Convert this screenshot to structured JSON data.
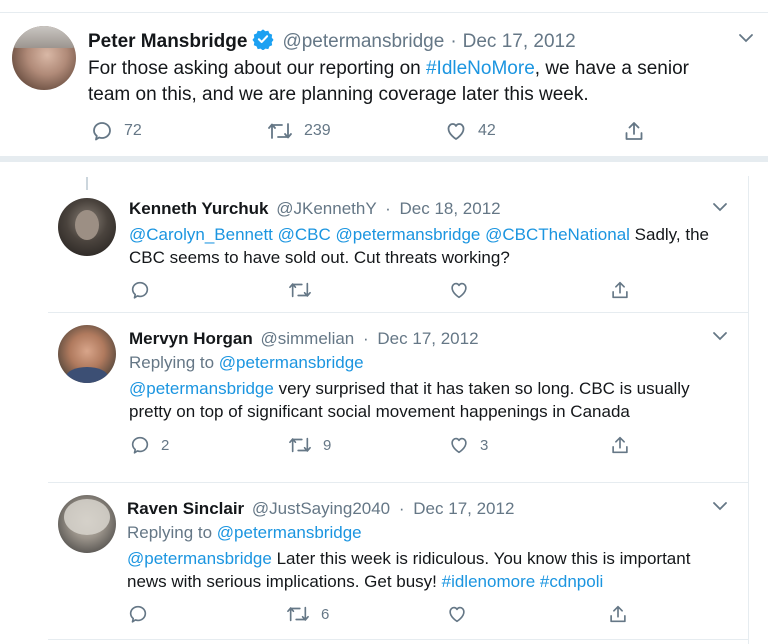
{
  "main_tweet": {
    "author_name": "Peter Mansbridge",
    "handle": "@petermansbridge",
    "sep": "·",
    "date": "Dec 17, 2012",
    "text_before": "For those asking about our reporting on ",
    "hashtag": "#IdleNoMore",
    "text_after": ", we have a senior team on this, and we are planning coverage later this week.",
    "reply_count": "72",
    "retweet_count": "239",
    "like_count": "42",
    "verified": true
  },
  "replies": [
    {
      "author_name": "Kenneth Yurchuk",
      "handle": "@JKennethY",
      "sep": "·",
      "date": "Dec 18, 2012",
      "mentions": [
        "@Carolyn_Bennett",
        "@CBC",
        "@petermansbridge",
        "@CBCTheNational"
      ],
      "text": " Sadly, the CBC seems to have sold out. Cut threats working?",
      "reply_count": "",
      "retweet_count": "",
      "like_count": ""
    },
    {
      "author_name": "Mervyn Horgan",
      "handle": "@simmelian",
      "sep": "·",
      "date": "Dec 17, 2012",
      "replying_label": "Replying to ",
      "replying_handle": "@petermansbridge",
      "mention": "@petermansbridge",
      "text": " very surprised that it has taken so long. CBC is usually pretty on top of significant social movement happenings in Canada",
      "reply_count": "2",
      "retweet_count": "9",
      "like_count": "3"
    },
    {
      "author_name": "Raven Sinclair",
      "handle": "@JustSaying2040",
      "sep": "·",
      "date": "Dec 17, 2012",
      "replying_label": "Replying to ",
      "replying_handle": "@petermansbridge",
      "mention": "@petermansbridge",
      "text": " Later this week is ridiculous. You know this is important news with serious implications. Get busy! ",
      "hashtags": [
        "#idlenomore",
        "#cdnpoli"
      ],
      "reply_count": "",
      "retweet_count": "6",
      "like_count": ""
    }
  ],
  "colors": {
    "link": "#1b95e0",
    "muted": "#657786",
    "verified": "#1da1f2",
    "divider": "#e6ecf0"
  }
}
